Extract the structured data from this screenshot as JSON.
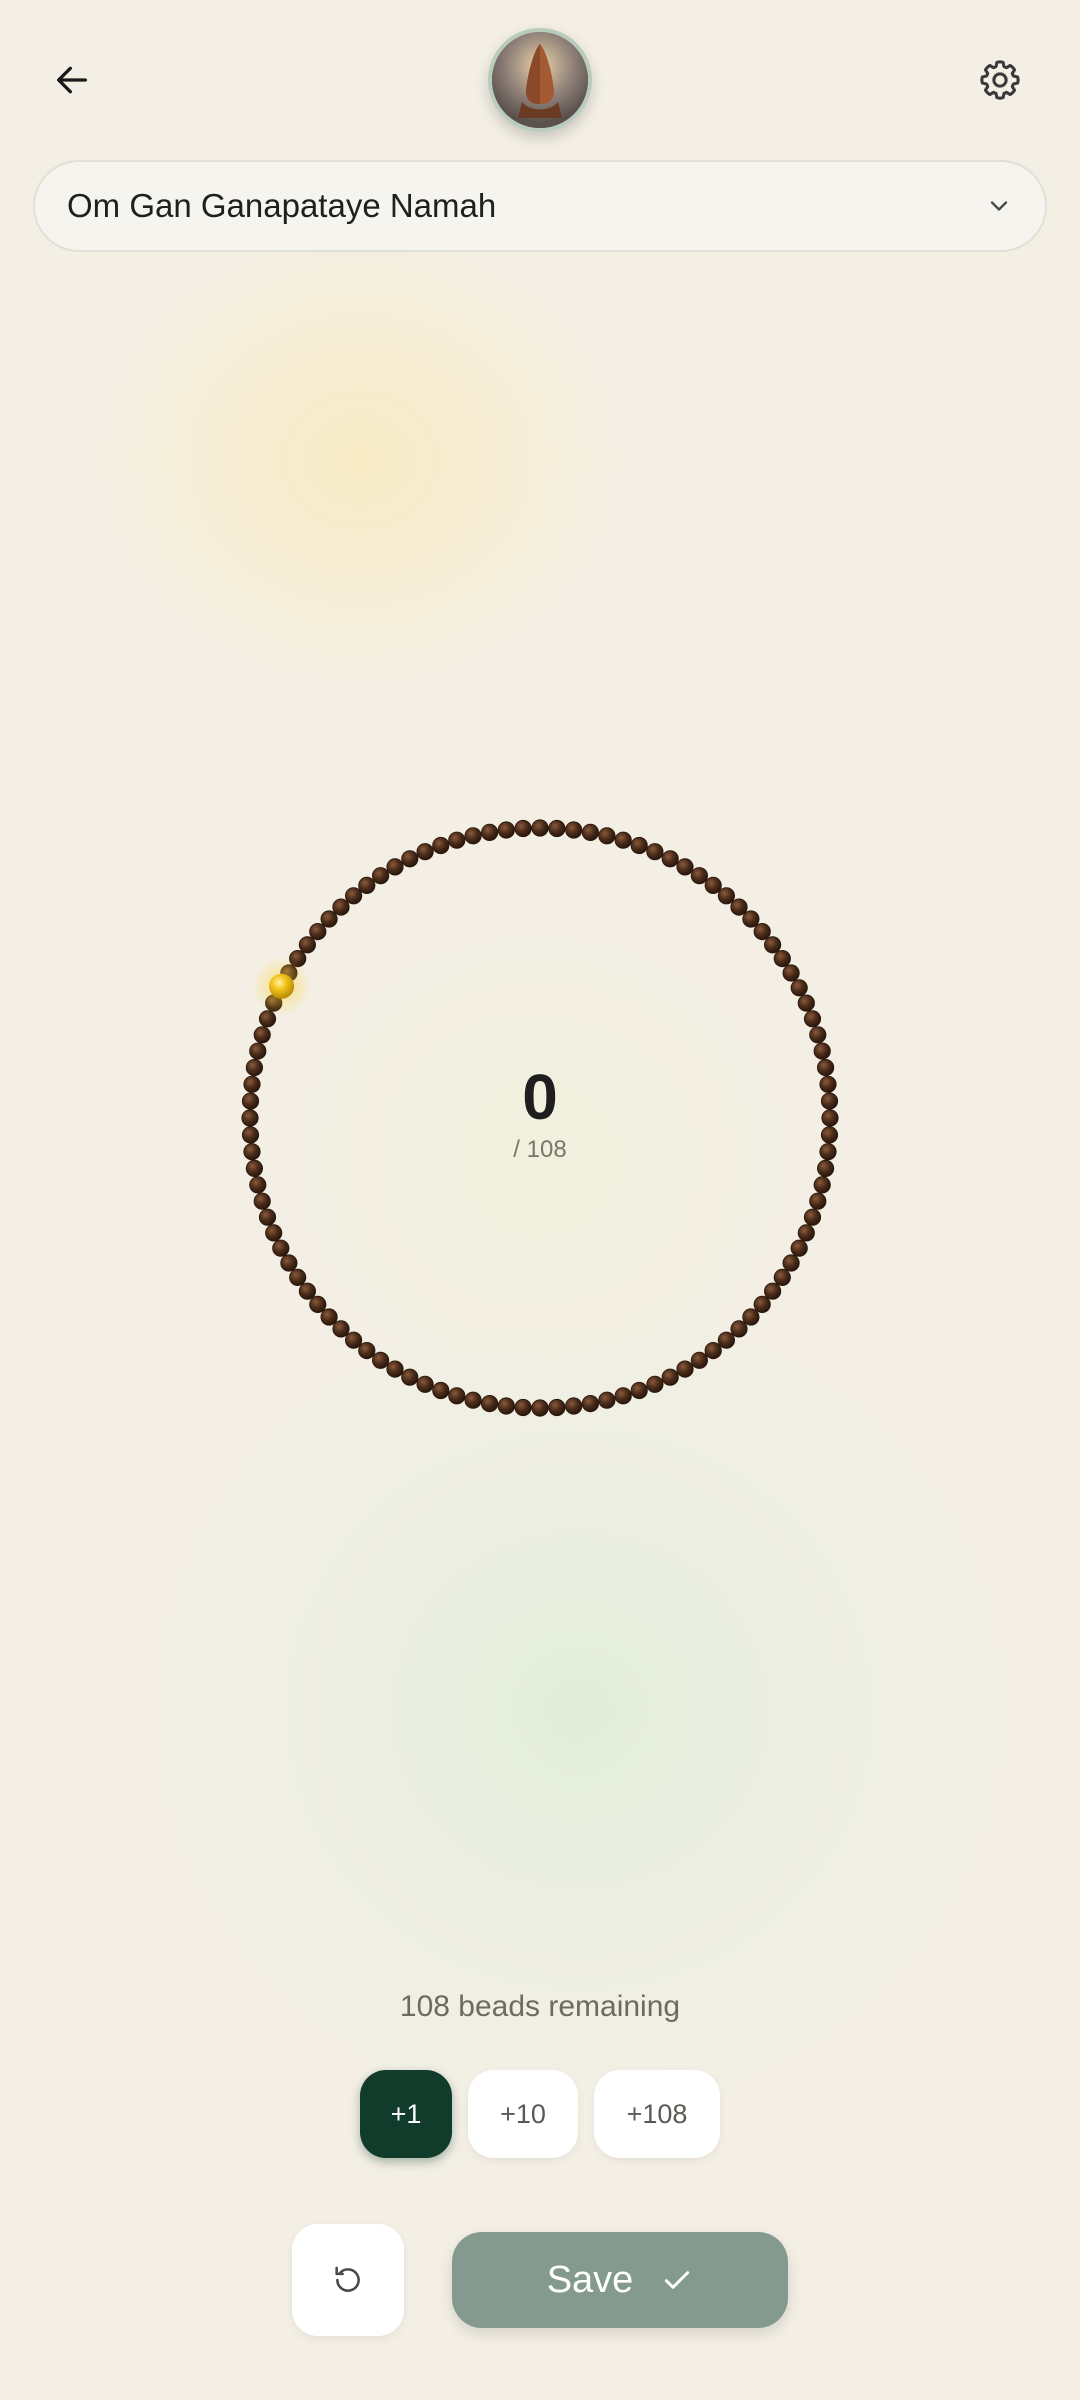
{
  "header": {
    "back_icon": "arrow-left-icon",
    "avatar_image": "praying-hands-image",
    "settings_icon": "gear-icon"
  },
  "mantra": {
    "selected": "Om Gan Ganapataye Namah",
    "chevron_icon": "chevron-down-icon"
  },
  "mala": {
    "bead_count": 108,
    "current_count": "0",
    "total_label": "/ 108",
    "bead_color": "#4a2c1a",
    "marker_color": "#f2c21a"
  },
  "status": {
    "remaining_text": "108 beads remaining"
  },
  "increments": {
    "one": "+1",
    "ten": "+10",
    "full": "+108"
  },
  "actions": {
    "reset_icon": "reset-icon",
    "save_label": "Save",
    "save_icon": "check-icon"
  },
  "colors": {
    "primary_dark": "#113b2b",
    "save_bg": "#849a8e",
    "background": "#f3efe5"
  }
}
